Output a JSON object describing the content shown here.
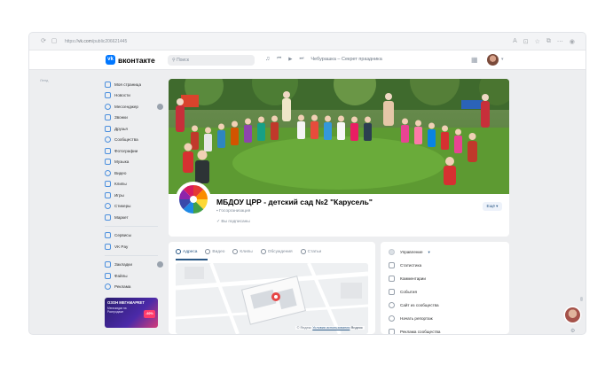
{
  "browser": {
    "url_prefix": "https://",
    "url_domain": "vk.com",
    "url_path": "/public206621445"
  },
  "header": {
    "logo_text": "вконтакте",
    "search_placeholder": "Поиск",
    "player_track": "Чебурашка – Секрет праздника"
  },
  "left_note": "Ленд",
  "sidebar": {
    "items": [
      {
        "label": "Моя страница",
        "icon": "home-icon"
      },
      {
        "label": "Новости",
        "icon": "news-icon"
      },
      {
        "label": "Мессенджер",
        "icon": "messenger-icon",
        "badge": true
      },
      {
        "label": "Звонки",
        "icon": "phone-icon"
      },
      {
        "label": "Друзья",
        "icon": "friends-icon"
      },
      {
        "label": "Сообщества",
        "icon": "communities-icon"
      },
      {
        "label": "Фотографии",
        "icon": "photos-icon"
      },
      {
        "label": "Музыка",
        "icon": "music-icon"
      },
      {
        "label": "Видео",
        "icon": "video-icon"
      },
      {
        "label": "Клипы",
        "icon": "clips-icon"
      },
      {
        "label": "Игры",
        "icon": "games-icon"
      },
      {
        "label": "Стикеры",
        "icon": "stickers-icon"
      },
      {
        "label": "Маркет",
        "icon": "market-icon"
      }
    ],
    "items2": [
      {
        "label": "Сервисы",
        "icon": "services-icon"
      },
      {
        "label": "VK Pay",
        "icon": "vkpay-icon"
      }
    ],
    "items3": [
      {
        "label": "Закладки",
        "icon": "bookmarks-icon",
        "badge": true
      },
      {
        "label": "Файлы",
        "icon": "files-icon"
      },
      {
        "label": "Реклама",
        "icon": "ads-icon"
      }
    ],
    "promo_title": "ОЗОН МЕГАМАРКЕТ",
    "promo_sub": "Мегаскидки на Распродаже",
    "promo_badge": "-60%"
  },
  "group": {
    "name": "МБДОУ ЦРР - детский сад №2 \"Карусель\"",
    "type": "Госорганизация",
    "subscribed": "Вы подписаны",
    "you_button": "Ещё"
  },
  "tabs": [
    {
      "label": "Адреса",
      "active": true
    },
    {
      "label": "Видео",
      "active": false
    },
    {
      "label": "Клипы",
      "active": false
    },
    {
      "label": "Обсуждения",
      "active": false
    },
    {
      "label": "Статьи",
      "active": false
    }
  ],
  "map": {
    "footer_brand": "© Яндекс",
    "footer_terms": "Условия использования",
    "footer_logo": "Яндекс"
  },
  "manage": {
    "head": "Управление",
    "items": [
      "Статистика",
      "Комментарии",
      "События",
      "Сайт из сообщества",
      "Начать репортаж",
      "Реклама сообщества"
    ]
  },
  "colors": {
    "accent": "#0077ff",
    "link": "#2a5885",
    "background": "#edeef0"
  }
}
